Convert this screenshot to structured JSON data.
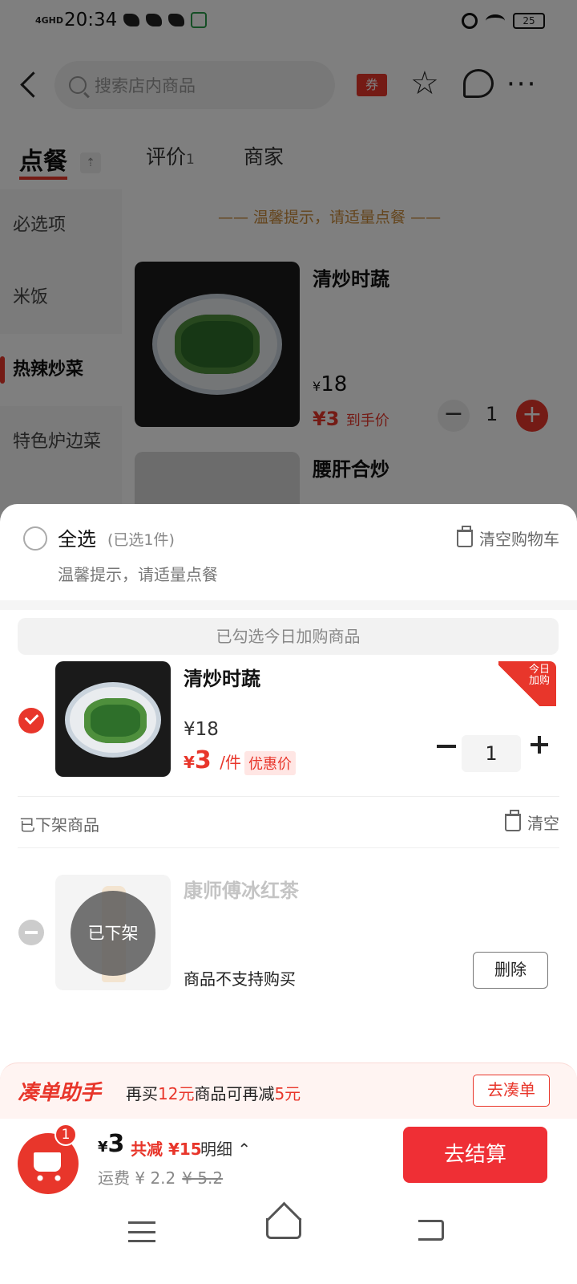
{
  "status_bar": {
    "network": "4GHD",
    "time": "20:34",
    "battery": "25"
  },
  "header": {
    "search_placeholder": "搜索店内商品",
    "coupon_label": "券"
  },
  "tabs": [
    {
      "label": "点餐"
    },
    {
      "label": "评价",
      "count": "1"
    },
    {
      "label": "商家"
    }
  ],
  "sidebar": {
    "items": [
      {
        "label": "必选项"
      },
      {
        "label": "米饭"
      },
      {
        "label": "热辣炒菜",
        "active": true
      },
      {
        "label": "特色炉边菜"
      }
    ]
  },
  "menu": {
    "tip": "—— 温馨提示，请适量点餐 ——",
    "dishes": [
      {
        "name": "清炒时蔬",
        "price_currency": "¥",
        "price": "18",
        "deal_price": "¥3",
        "deal_label": "到手价",
        "quantity": "1"
      },
      {
        "name": "腰肝合炒"
      }
    ]
  },
  "cart": {
    "select_all_label": "全选",
    "selected_count": "(已选1件)",
    "clear_cart_label": "清空购物车",
    "tip": "温馨提示，请适量点餐",
    "section_today": "已勾选今日加购商品",
    "item": {
      "name": "清炒时蔬",
      "price": "¥18",
      "deal_currency": "¥",
      "deal_price": "3",
      "deal_unit": "/件",
      "deal_badge": "优惠价",
      "corner_tag": "今日加购",
      "quantity": "1"
    },
    "offshelf_header": "已下架商品",
    "offshelf_clear_label": "清空",
    "offshelf_item": {
      "name": "康师傅冰红茶",
      "status": "已下架",
      "note": "商品不支持购买",
      "delete_label": "删除"
    }
  },
  "assistant": {
    "title": "凑单助手",
    "text_prefix": "再买",
    "amount": "12元",
    "text_middle": "商品可再减",
    "reduce": "5元",
    "button": "去凑单"
  },
  "checkout": {
    "badge": "1",
    "currency": "¥",
    "total": "3",
    "discount": "共减 ¥15",
    "detail": "明细 ⌃",
    "delivery": "运费 ¥ 2.2",
    "delivery_original": "¥ 5.2",
    "button": "去结算"
  },
  "colors": {
    "accent": "#e8362b",
    "checkout_button": "#ef2f35"
  }
}
